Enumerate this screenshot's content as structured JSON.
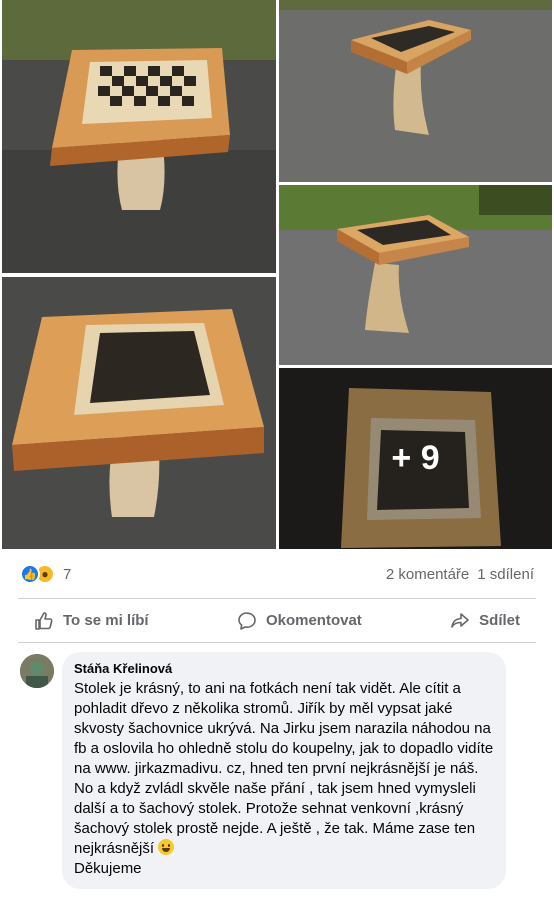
{
  "gallery": {
    "more_overlay": "+ 9"
  },
  "stats": {
    "reaction_count": "7",
    "comments": "2 komentáře",
    "shares": "1 sdílení"
  },
  "actions": {
    "like": "To se mi líbí",
    "comment": "Okomentovat",
    "share": "Sdílet"
  },
  "comment": {
    "author": "Stáňa Křelinová",
    "text": "Stolek je krásný, to ani na fotkách není tak vidět. Ale cítit a pohladit dřevo z několika stromů. Jiřík by měl vypsat jaké skvosty šachovnice ukrývá. Na Jirku jsem narazila náhodou na fb a oslovila ho ohledně stolu do koupelny, jak to dopadlo vidíte na www. jirkazmadivu. cz, hned ten první nejkrásnější je náš. No a když zvládl skvěle naše přání , tak jsem hned vymysleli další a to šachový stolek. Protože sehnat venkovní ,krásný šachový stolek prostě nejde. A ještě , že tak. Máme zase ten nejkrásnější",
    "text_end": "Děkujeme"
  },
  "colors": {
    "like_blue": "#1877f2",
    "wow_yellow": "#f7b928",
    "muted_text": "#65676b",
    "bubble_bg": "#f0f2f5"
  },
  "icons": [
    "like-reaction-icon",
    "wow-reaction-icon",
    "thumbs-up-icon",
    "comment-icon",
    "share-icon",
    "smile-emoji-icon"
  ]
}
